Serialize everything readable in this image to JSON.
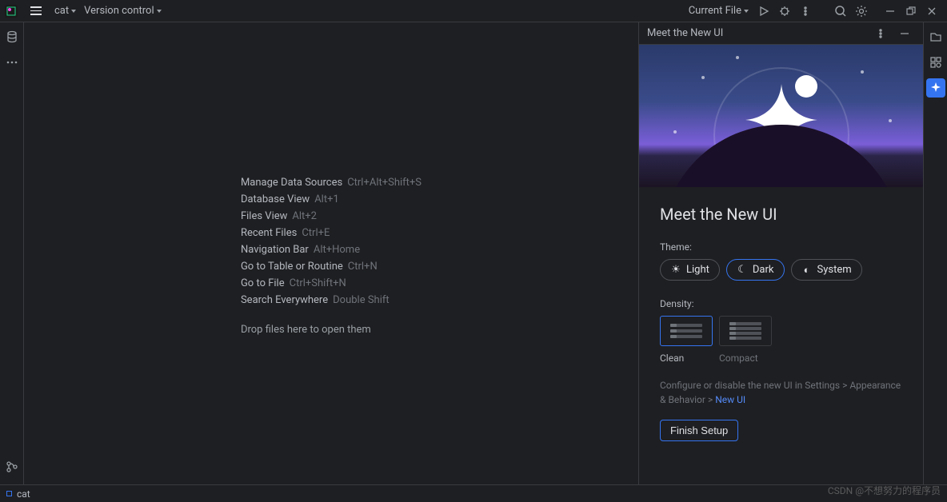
{
  "toolbar": {
    "breadcrumb": "cat",
    "vcs": "Version control",
    "run_config": "Current File"
  },
  "editor_actions": [
    {
      "label": "Manage Data Sources",
      "shortcut": "Ctrl+Alt+Shift+S"
    },
    {
      "label": "Database View",
      "shortcut": "Alt+1"
    },
    {
      "label": "Files View",
      "shortcut": "Alt+2"
    },
    {
      "label": "Recent Files",
      "shortcut": "Ctrl+E"
    },
    {
      "label": "Navigation Bar",
      "shortcut": "Alt+Home"
    },
    {
      "label": "Go to Table or Routine",
      "shortcut": "Ctrl+N"
    },
    {
      "label": "Go to File",
      "shortcut": "Ctrl+Shift+N"
    },
    {
      "label": "Search Everywhere",
      "shortcut": "Double Shift"
    }
  ],
  "editor_drop_hint": "Drop files here to open them",
  "side_panel": {
    "header": "Meet the New UI",
    "title": "Meet the New UI",
    "theme_label": "Theme:",
    "themes": {
      "light": "Light",
      "dark": "Dark",
      "system": "System"
    },
    "density_label": "Density:",
    "density": {
      "clean": "Clean",
      "compact": "Compact"
    },
    "help_text": "Configure or disable the new UI in Settings > Appearance & Behavior > ",
    "help_link": "New UI",
    "finish_button": "Finish Setup"
  },
  "status": {
    "project": "cat"
  },
  "watermark": "CSDN @不想努力的程序员"
}
